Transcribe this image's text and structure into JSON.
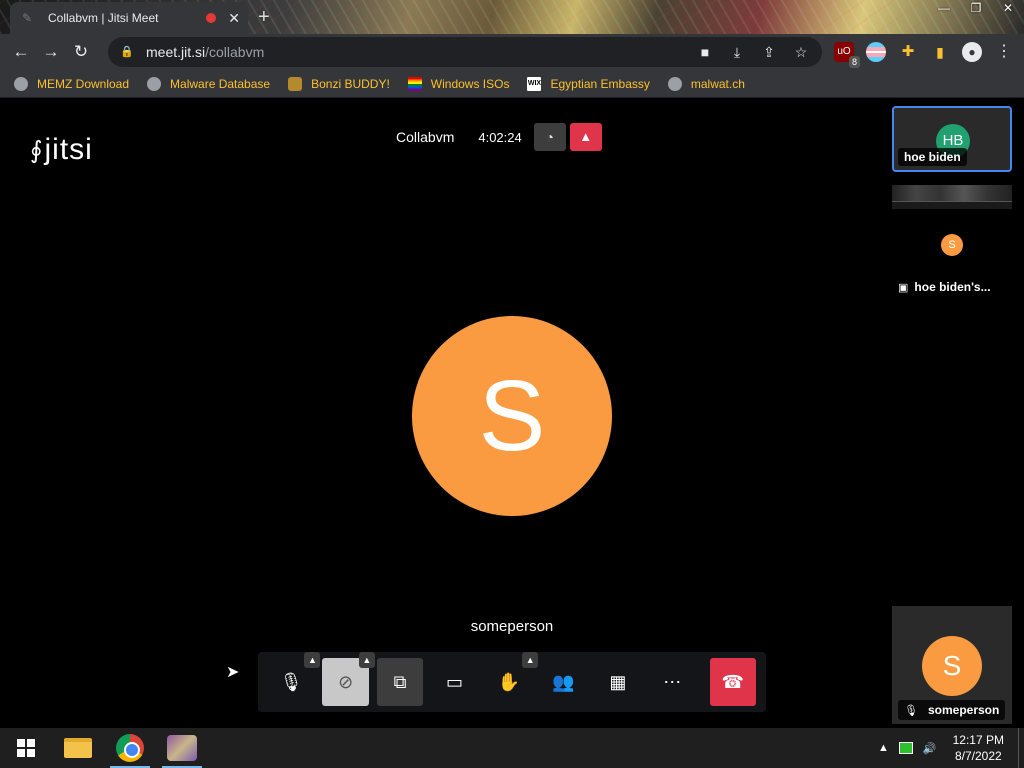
{
  "browser": {
    "tab_title": "Collabvm | Jitsi Meet",
    "tab_close": "✕",
    "new_tab": "+",
    "window_controls": {
      "minimize": "—",
      "maximize": "❐",
      "close": "✕"
    },
    "url_host": "meet.jit.si",
    "url_path": "/collabvm",
    "ublock_badge": "8",
    "profile_icon": "person-icon"
  },
  "bookmarks": [
    {
      "label": "MEMZ Download",
      "icon": "globe-icon"
    },
    {
      "label": "Malware Database",
      "icon": "globe-icon"
    },
    {
      "label": "Bonzi BUDDY!",
      "icon": "bonzi-icon"
    },
    {
      "label": "Windows ISOs",
      "icon": "rainbow-flag-icon"
    },
    {
      "label": "Egyptian Embassy",
      "icon": "wix-icon"
    },
    {
      "label": "malwat.ch",
      "icon": "globe-icon"
    }
  ],
  "meeting": {
    "logo_text": "jitsi",
    "name": "Collabvm",
    "timer": "4:02:24",
    "dominant_speaker_initial": "S",
    "dominant_speaker_name": "someperson",
    "avatar_color": "#fb9b41"
  },
  "filmstrip": {
    "participant_1_initials": "HB",
    "participant_1_name": "hoe biden",
    "participant_1_color": "#21a070",
    "screen_share_initial": "S",
    "screen_share_name": "hoe biden's...",
    "self_initial": "S",
    "self_name": "someperson"
  },
  "toolbar": {
    "buttons": [
      "microphone",
      "camera",
      "share-screen",
      "chat",
      "raise-hand",
      "participants",
      "tile-view",
      "more-actions",
      "hangup"
    ],
    "hangup_color": "#e0344a"
  },
  "taskbar": {
    "time": "12:17 PM",
    "date": "8/7/2022",
    "tray_chevron": "▲"
  }
}
